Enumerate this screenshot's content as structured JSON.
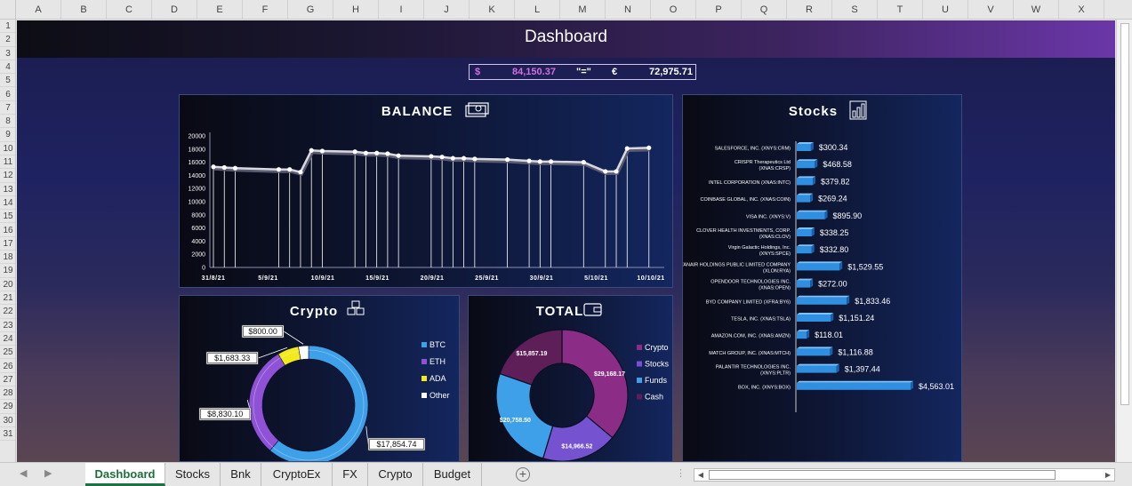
{
  "columns": [
    "A",
    "B",
    "C",
    "D",
    "E",
    "F",
    "G",
    "H",
    "I",
    "J",
    "K",
    "L",
    "M",
    "N",
    "O",
    "P",
    "Q",
    "R",
    "S",
    "T",
    "U",
    "V",
    "W",
    "X"
  ],
  "rows": [
    "1",
    "2",
    "3",
    "4",
    "5",
    "6",
    "7",
    "8",
    "9",
    "10",
    "11",
    "12",
    "13",
    "14",
    "15",
    "16",
    "17",
    "18",
    "19",
    "20",
    "21",
    "22",
    "23",
    "24",
    "25",
    "26",
    "27",
    "28",
    "29",
    "30",
    "31"
  ],
  "dashboard": {
    "title": "Dashboard",
    "usd_symbol": "$",
    "usd_value": "84,150.37",
    "equals": "\"=\"",
    "eur_symbol": "€",
    "eur_value": "72,975.71"
  },
  "colors": {
    "accent": "#6b37a8",
    "btc": "#3ea0e8",
    "eth": "#8f52d6",
    "ada": "#f2ea1c",
    "other": "#ffffff",
    "cash": "#5e1e58",
    "crypto": "#8b2c86",
    "stocks": "#7552cf",
    "funds": "#3ea0e8"
  },
  "icons": {
    "balance": "money-icon",
    "stocks": "bar-chart-icon",
    "crypto": "blocks-icon",
    "total": "wallet-icon"
  },
  "chart_data": [
    {
      "type": "line",
      "title": "BALANCE",
      "ylim": [
        0,
        20000
      ],
      "yticks": [
        "20000",
        "18000",
        "16000",
        "14000",
        "12000",
        "10000",
        "8000",
        "6000",
        "4000",
        "2000",
        "0"
      ],
      "xticks": [
        "31/8/21",
        "5/9/21",
        "10/9/21",
        "15/9/21",
        "20/9/21",
        "25/9/21",
        "30/9/21",
        "5/10/21",
        "10/10/21"
      ],
      "xrange": [
        0,
        41
      ],
      "x": [
        0,
        1,
        2,
        6,
        7,
        8,
        9,
        10,
        13,
        14,
        15,
        16,
        17,
        20,
        21,
        22,
        23,
        24,
        27,
        29,
        30,
        31,
        34,
        36,
        37,
        38,
        40
      ],
      "y": [
        15300,
        15200,
        15100,
        14900,
        14900,
        14500,
        17800,
        17700,
        17600,
        17400,
        17400,
        17300,
        17000,
        16900,
        16800,
        16600,
        16600,
        16500,
        16400,
        16200,
        16100,
        16100,
        16000,
        14600,
        14600,
        18100,
        18200
      ]
    },
    {
      "type": "bar",
      "title": "Stocks",
      "categories": [
        "SALESFORCE, INC. (XNYS:CRM)",
        "CRISPR Therapeutics Ltd (XNAS:CRSP)",
        "INTEL CORPORATION (XNAS:INTC)",
        "COINBASE GLOBAL, INC. (XNAS:COIN)",
        "VISA INC. (XNYS:V)",
        "CLOVER HEALTH INVESTMENTS, CORP. (XNAS:CLOV)",
        "Virgin Galactic Holdings, Inc. (XNYS:SPCE)",
        "RYANAIR HOLDINGS PUBLIC LIMITED COMPANY (XLON:RYA)",
        "OPENDOOR TECHNOLOGIES INC. (XNAS:OPEN)",
        "BYD COMPANY LIMITED (XFRA:BY6)",
        "TESLA, INC. (XNAS:TSLA)",
        "AMAZON.COM, INC. (XNAS:AMZN)",
        "MATCH GROUP, INC. (XNAS:MTCH)",
        "PALANTIR TECHNOLOGIES INC. (XNYS:PLTR)",
        "BOX, INC. (XNYS:BOX)"
      ],
      "values": [
        300.34,
        468.58,
        379.82,
        269.24,
        895.9,
        338.25,
        332.8,
        1529.55,
        272.0,
        1833.46,
        1151.24,
        118.01,
        1116.88,
        1397.44,
        4563.01
      ],
      "labels": [
        "$300.34",
        "$468.58",
        "$379.82",
        "$269.24",
        "$895.90",
        "$338.25",
        "$332.80",
        "$1,529.55",
        "$272.00",
        "$1,833.46",
        "$1,151.24",
        "$118.01",
        "$1,116.88",
        "$1,397.44",
        "$4,563.01"
      ]
    },
    {
      "type": "pie",
      "title": "Crypto",
      "categories": [
        "BTC",
        "ETH",
        "ADA",
        "Other"
      ],
      "values": [
        17854.74,
        8830.1,
        1683.33,
        800.0
      ],
      "labels": [
        "$17,854.74",
        "$8,830.10",
        "$1,683.33",
        "$800.00"
      ]
    },
    {
      "type": "pie",
      "title": "TOTAL",
      "categories": [
        "Crypto",
        "Stocks",
        "Funds",
        "Cash"
      ],
      "values": [
        29168.17,
        14966.52,
        20758.5,
        15857.19
      ],
      "labels": [
        "$29,168.17",
        "$14,966.52",
        "$20,758.50",
        "$15,857.19"
      ]
    }
  ],
  "tabs": [
    "Dashboard",
    "Stocks",
    "Bnk",
    "CryptoEx",
    "FX",
    "Crypto",
    "Budget"
  ]
}
